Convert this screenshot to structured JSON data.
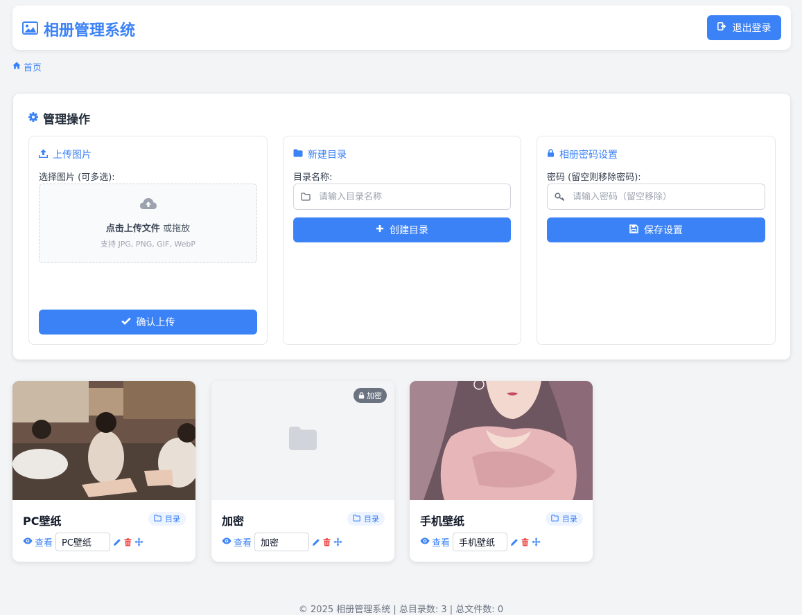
{
  "header": {
    "title": "相册管理系统",
    "logout_label": "退出登录"
  },
  "breadcrumb": {
    "home_label": "首页"
  },
  "admin": {
    "title": "管理操作",
    "upload": {
      "title": "上传图片",
      "label": "选择图片 (可多选):",
      "drop_strong": "点击上传文件",
      "drop_rest": " 或拖放",
      "drop_hint": "支持 JPG, PNG, GIF, WebP",
      "button": "确认上传"
    },
    "new_dir": {
      "title": "新建目录",
      "label": "目录名称:",
      "placeholder": "请输入目录名称",
      "button": "创建目录"
    },
    "password": {
      "title": "相册密码设置",
      "label": "密码 (留空则移除密码):",
      "placeholder": "请输入密码（留空移除）",
      "button": "保存设置"
    }
  },
  "albums": [
    {
      "name": "PC壁纸",
      "tag": "目录",
      "view_label": "查看",
      "rename_value": "PC壁纸",
      "locked": false
    },
    {
      "name": "加密",
      "tag": "目录",
      "view_label": "查看",
      "rename_value": "加密",
      "locked": true,
      "lock_label": "加密"
    },
    {
      "name": "手机壁纸",
      "tag": "目录",
      "view_label": "查看",
      "rename_value": "手机壁纸",
      "locked": false
    }
  ],
  "footer": {
    "text": "© 2025 相册管理系统 | 总目录数: 3 | 总文件数: 0"
  },
  "colors": {
    "accent": "#3b82f6",
    "danger": "#ef4444",
    "background": "#f3f4f6"
  }
}
